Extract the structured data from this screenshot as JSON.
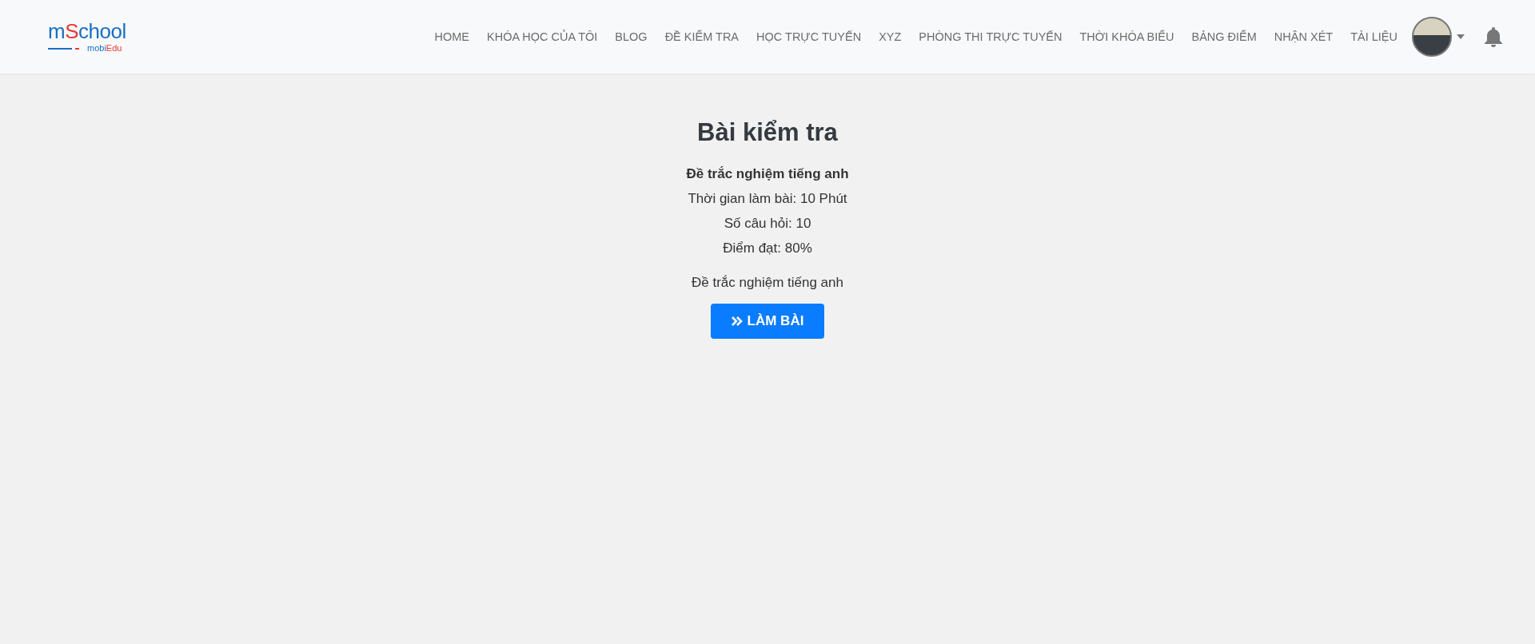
{
  "header": {
    "logo": {
      "m": "m",
      "s": "S",
      "rest": "chool",
      "sub_a": "mobi",
      "sub_b": "Edu"
    },
    "nav": [
      {
        "label": "HOME"
      },
      {
        "label": "KHÓA HỌC CỦA TÔI"
      },
      {
        "label": "BLOG"
      },
      {
        "label": "ĐỀ KIỂM TRA"
      },
      {
        "label": "HỌC TRỰC TUYẾN"
      },
      {
        "label": "XYZ"
      },
      {
        "label": "PHÒNG THI TRỰC TUYẾN"
      },
      {
        "label": "THỜI KHÓA BIỂU"
      },
      {
        "label": "BẢNG ĐIỂM"
      },
      {
        "label": "NHẬN XÉT"
      },
      {
        "label": "TÀI LIỆU"
      }
    ]
  },
  "test": {
    "title": "Bài kiểm tra",
    "name": "Đề trắc nghiệm tiếng anh",
    "details": [
      "Thời gian làm bài: 10 Phút",
      "Số câu hỏi: 10",
      "Điểm đạt: 80%"
    ],
    "description": "Đề trắc nghiệm tiếng anh",
    "button": "LÀM BÀI"
  }
}
